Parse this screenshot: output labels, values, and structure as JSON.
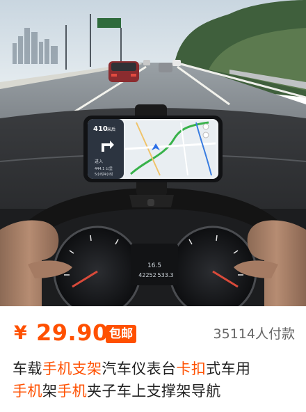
{
  "product": {
    "price": {
      "currency_symbol": "¥",
      "amount": "29.90",
      "badge": "包邮",
      "sold_count": "35114人付款"
    },
    "title": {
      "segments": [
        {
          "text": "车载",
          "highlight": false
        },
        {
          "text": "手机支架",
          "highlight": true
        },
        {
          "text": "汽车仪表台",
          "highlight": false
        },
        {
          "text": "卡扣",
          "highlight": true
        },
        {
          "text": "式车用",
          "highlight": false
        },
        {
          "text": "手机",
          "highlight": true
        },
        {
          "text": "架",
          "highlight": false
        },
        {
          "text": "手机",
          "highlight": true
        },
        {
          "text": "夹子车上支撑架导航",
          "highlight": false
        }
      ]
    },
    "photo_screen": {
      "distance": "410",
      "distance_unit": "米后",
      "turn_label": "进入",
      "remaining": "444.1 公里",
      "eta": "5小时4小时"
    },
    "dashboard": {
      "temperature": "16.5",
      "odometer": "42252",
      "trip": "533.3"
    }
  },
  "colors": {
    "accent": "#ff5000",
    "text": "#222222",
    "muted": "#666666"
  }
}
